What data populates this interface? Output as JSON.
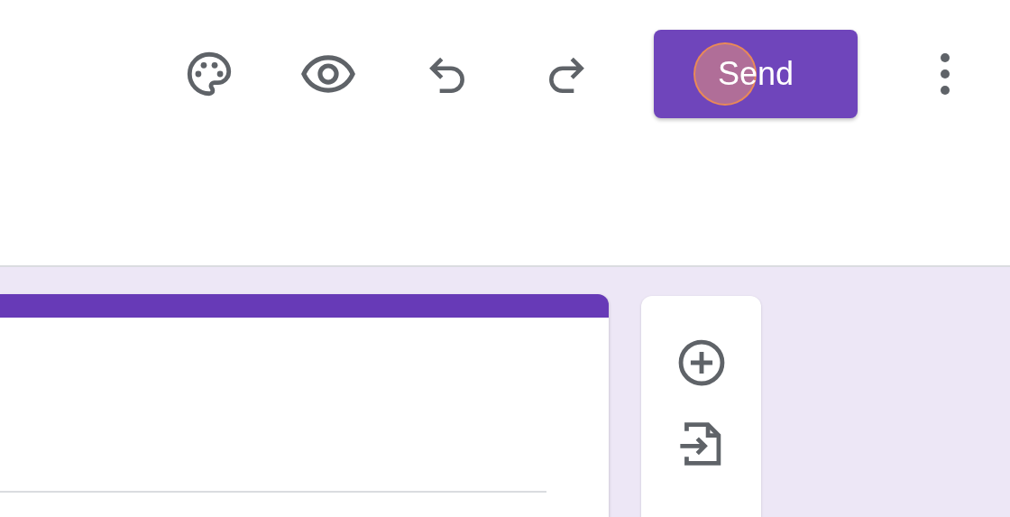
{
  "send_button": {
    "label": "Send"
  }
}
